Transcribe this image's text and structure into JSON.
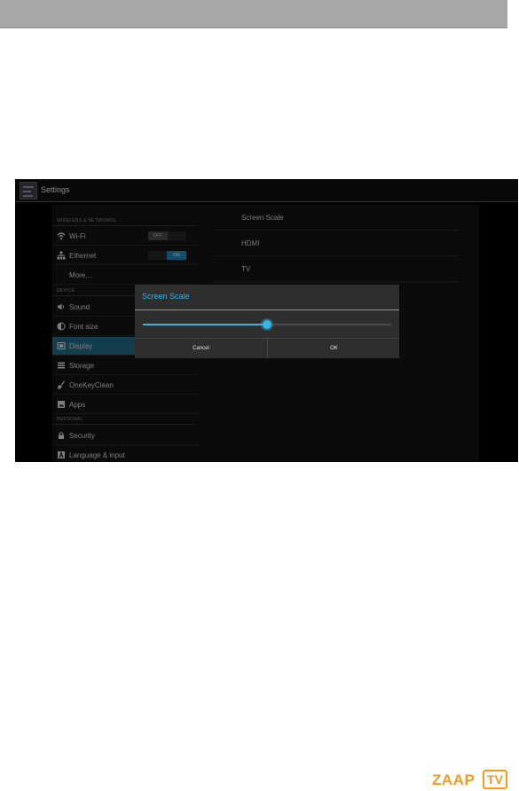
{
  "app": {
    "title": "Settings"
  },
  "sidebar": {
    "categories": [
      "WIRELESS & NETWORKS",
      "DEVICE",
      "PERSONAL"
    ],
    "items": [
      {
        "label": "Wi-Fi",
        "icon": "wifi-icon"
      },
      {
        "label": "Ethernet",
        "icon": "ethernet-icon"
      },
      {
        "label": "More…",
        "icon": ""
      },
      {
        "label": "Sound",
        "icon": "speaker-icon"
      },
      {
        "label": "Font size",
        "icon": "contrast-icon"
      },
      {
        "label": "Display",
        "icon": "display-icon",
        "selected": true
      },
      {
        "label": "Storage",
        "icon": "storage-icon"
      },
      {
        "label": "OneKeyClean",
        "icon": "broom-icon"
      },
      {
        "label": "Apps",
        "icon": "apps-icon"
      },
      {
        "label": "Security",
        "icon": "lock-icon"
      },
      {
        "label": "Language & input",
        "icon": "keyboard-icon"
      }
    ],
    "toggles": {
      "wifi": "OFF",
      "ethernet": "ON"
    }
  },
  "detail": {
    "items": [
      "Screen Scale",
      "HDMI",
      "TV"
    ]
  },
  "dialog": {
    "title": "Screen Scale",
    "slider_value": 0.5,
    "cancel_label": "Cancel",
    "ok_label": "OK"
  },
  "brand": {
    "name": "ZAAP",
    "badge": "TV"
  },
  "colors": {
    "accent": "#33b5e5",
    "selected_row": "#1f6b87",
    "brand": "#f39a1f"
  }
}
